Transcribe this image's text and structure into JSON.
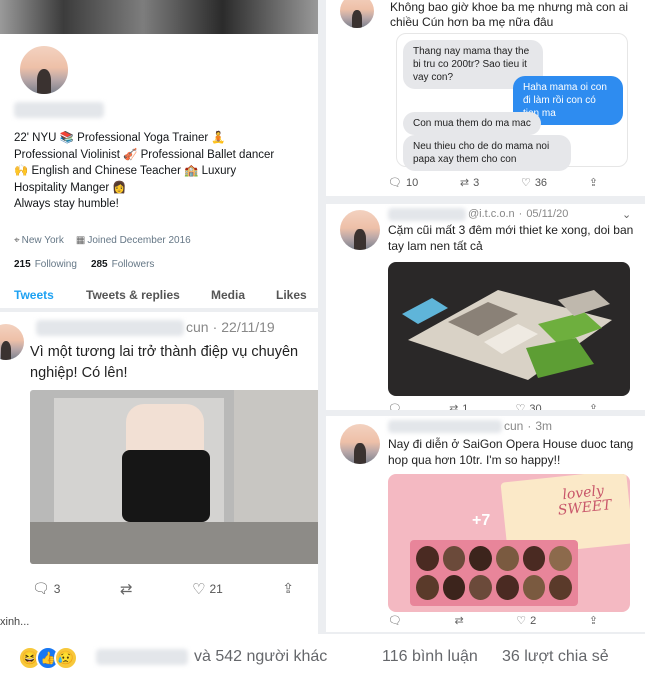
{
  "profile": {
    "bio": [
      "22' NYU 📚 Professional Yoga Trainer 🧘",
      "Professional Violinist 🎻 Professional Ballet dancer",
      "🙌 English and Chinese Teacher 🏫 Luxury",
      "Hospitality Manger 👩",
      "Always stay humble!"
    ],
    "location": "New York",
    "joined": "Joined December 2016",
    "following_count": "215",
    "following_label": "Following",
    "followers_count": "285",
    "followers_label": "Followers",
    "tabs": [
      "Tweets",
      "Tweets & replies",
      "Media",
      "Likes"
    ]
  },
  "tweet_left": {
    "date": "22/11/19",
    "handle_suffix": "cun",
    "text": "Vì một tương lai trở thành điệp vụ chuyên nghiệp! Có lên!",
    "replies": "3",
    "likes": "21",
    "more_text": "xinh..."
  },
  "tweet_chat": {
    "text": "Không bao giờ khoe ba mẹ nhưng mà con ai chiều Cún hơn ba mẹ nữa đâu",
    "messages": [
      {
        "side": "left",
        "text": "Thang nay mama thay the bi tru co 200tr? Sao tieu it vay con?"
      },
      {
        "side": "right",
        "text": "Haha mama oi con đi làm rồi con có tien ma"
      },
      {
        "side": "left",
        "text": "Con mua them do ma mac"
      },
      {
        "side": "left",
        "text": "Neu thieu cho de do mama noi papa xay them cho con"
      }
    ],
    "replies": "10",
    "retweets": "3",
    "likes": "36"
  },
  "tweet_house": {
    "date": "05/11/20",
    "handle_suffix": "@i.t.c.o.n",
    "text": "Cặm cũi mất 3 đêm mới thiet ke xong, doi ban tay lam nen tất cả",
    "retweets": "1",
    "likes": "30"
  },
  "tweet_gift": {
    "time": "3m",
    "handle_suffix": "cun",
    "text": "Nay đi diễn ở SaiGon Opera House duoc tang hop qua hơn 10tr. I'm so happy!!",
    "photo_count": "+7",
    "box_text": "lovely SWEET",
    "likes": "2"
  },
  "fb_bar": {
    "others": "và 542 người khác",
    "comments": "116 bình luận",
    "shares": "36 lượt chia sẻ"
  }
}
